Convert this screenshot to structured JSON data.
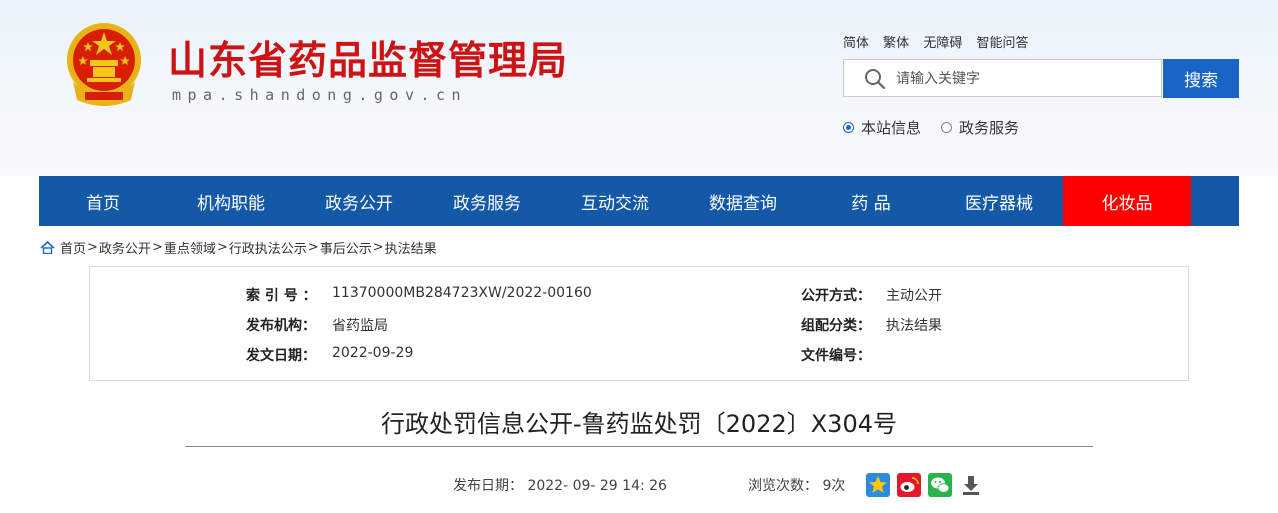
{
  "header": {
    "title": "山东省药品监督管理局",
    "url_text": "mpa.shandong.gov.cn",
    "emblem_icon": "national-emblem-icon",
    "top_links": [
      "简体",
      "繁体",
      "无障碍",
      "智能问答"
    ]
  },
  "search": {
    "placeholder": "请输入关键字",
    "button_label": "搜索",
    "scope_options": [
      {
        "label": "本站信息",
        "selected": true
      },
      {
        "label": "政务服务",
        "selected": false
      }
    ]
  },
  "nav": {
    "items": [
      "首页",
      "机构职能",
      "政务公开",
      "政务服务",
      "互动交流",
      "数据查询",
      "药 品",
      "医疗器械",
      "化妆品"
    ],
    "active_index": 8
  },
  "breadcrumb": [
    "首页",
    "政务公开",
    "重点领域",
    "行政执法公示",
    "事后公示",
    "执法结果"
  ],
  "meta": {
    "index_label": "索 引 号 ：",
    "index_value": "11370000MB284723XW/2022-00160",
    "publisher_label": "发布机构：",
    "publisher_value": "省药监局",
    "date_label": "发文日期：",
    "date_value": "2022-09-29",
    "open_label": "公开方式：",
    "open_value": "主动公开",
    "category_label": "组配分类：",
    "category_value": "执法结果",
    "docno_label": "文件编号：",
    "docno_value": ""
  },
  "article": {
    "title": "行政处罚信息公开-鲁药监处罚〔2022〕X304号",
    "publish_label": "发布日期：",
    "publish_value": "2022- 09- 29 14: 26",
    "views_label": "浏览次数：",
    "views_value": "9次",
    "share_icons": [
      "qzone-icon",
      "weibo-icon",
      "wechat-icon",
      "download-icon"
    ]
  },
  "colors": {
    "brand_red": "#cc1414",
    "nav_blue": "#1458a8",
    "nav_active": "#ff0000",
    "search_blue": "#1a64c6"
  }
}
